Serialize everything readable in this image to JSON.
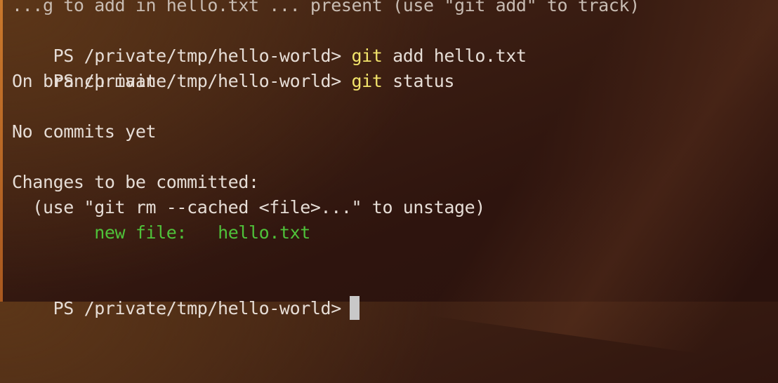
{
  "terminal": {
    "clipped_line": "...g to add in hello.txt ... present (use \"git add\" to track)",
    "line1": {
      "prompt": "PS /private/tmp/hello-world>",
      "cmd": "git",
      "args": "add hello.txt"
    },
    "line2": {
      "prompt": "PS /private/tmp/hello-world>",
      "cmd": "git",
      "args": "status"
    },
    "branch_line": "On branch main",
    "no_commits": "No commits yet",
    "changes_header": "Changes to be committed:",
    "hint": "  (use \"git rm --cached <file>...\" to unstage)",
    "staged": {
      "label": "new file:",
      "file": "hello.txt"
    },
    "final_prompt": "PS /private/tmp/hello-world>"
  }
}
